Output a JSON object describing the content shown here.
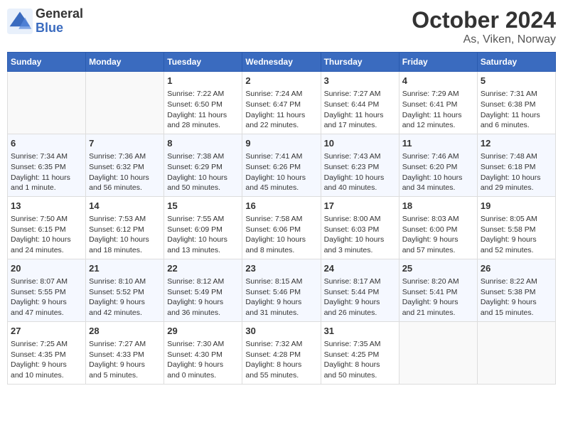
{
  "header": {
    "logo_line1": "General",
    "logo_line2": "Blue",
    "title": "October 2024",
    "subtitle": "As, Viken, Norway"
  },
  "weekdays": [
    "Sunday",
    "Monday",
    "Tuesday",
    "Wednesday",
    "Thursday",
    "Friday",
    "Saturday"
  ],
  "weeks": [
    [
      {
        "day": "",
        "info": ""
      },
      {
        "day": "",
        "info": ""
      },
      {
        "day": "1",
        "info": "Sunrise: 7:22 AM\nSunset: 6:50 PM\nDaylight: 11 hours\nand 28 minutes."
      },
      {
        "day": "2",
        "info": "Sunrise: 7:24 AM\nSunset: 6:47 PM\nDaylight: 11 hours\nand 22 minutes."
      },
      {
        "day": "3",
        "info": "Sunrise: 7:27 AM\nSunset: 6:44 PM\nDaylight: 11 hours\nand 17 minutes."
      },
      {
        "day": "4",
        "info": "Sunrise: 7:29 AM\nSunset: 6:41 PM\nDaylight: 11 hours\nand 12 minutes."
      },
      {
        "day": "5",
        "info": "Sunrise: 7:31 AM\nSunset: 6:38 PM\nDaylight: 11 hours\nand 6 minutes."
      }
    ],
    [
      {
        "day": "6",
        "info": "Sunrise: 7:34 AM\nSunset: 6:35 PM\nDaylight: 11 hours\nand 1 minute."
      },
      {
        "day": "7",
        "info": "Sunrise: 7:36 AM\nSunset: 6:32 PM\nDaylight: 10 hours\nand 56 minutes."
      },
      {
        "day": "8",
        "info": "Sunrise: 7:38 AM\nSunset: 6:29 PM\nDaylight: 10 hours\nand 50 minutes."
      },
      {
        "day": "9",
        "info": "Sunrise: 7:41 AM\nSunset: 6:26 PM\nDaylight: 10 hours\nand 45 minutes."
      },
      {
        "day": "10",
        "info": "Sunrise: 7:43 AM\nSunset: 6:23 PM\nDaylight: 10 hours\nand 40 minutes."
      },
      {
        "day": "11",
        "info": "Sunrise: 7:46 AM\nSunset: 6:20 PM\nDaylight: 10 hours\nand 34 minutes."
      },
      {
        "day": "12",
        "info": "Sunrise: 7:48 AM\nSunset: 6:18 PM\nDaylight: 10 hours\nand 29 minutes."
      }
    ],
    [
      {
        "day": "13",
        "info": "Sunrise: 7:50 AM\nSunset: 6:15 PM\nDaylight: 10 hours\nand 24 minutes."
      },
      {
        "day": "14",
        "info": "Sunrise: 7:53 AM\nSunset: 6:12 PM\nDaylight: 10 hours\nand 18 minutes."
      },
      {
        "day": "15",
        "info": "Sunrise: 7:55 AM\nSunset: 6:09 PM\nDaylight: 10 hours\nand 13 minutes."
      },
      {
        "day": "16",
        "info": "Sunrise: 7:58 AM\nSunset: 6:06 PM\nDaylight: 10 hours\nand 8 minutes."
      },
      {
        "day": "17",
        "info": "Sunrise: 8:00 AM\nSunset: 6:03 PM\nDaylight: 10 hours\nand 3 minutes."
      },
      {
        "day": "18",
        "info": "Sunrise: 8:03 AM\nSunset: 6:00 PM\nDaylight: 9 hours\nand 57 minutes."
      },
      {
        "day": "19",
        "info": "Sunrise: 8:05 AM\nSunset: 5:58 PM\nDaylight: 9 hours\nand 52 minutes."
      }
    ],
    [
      {
        "day": "20",
        "info": "Sunrise: 8:07 AM\nSunset: 5:55 PM\nDaylight: 9 hours\nand 47 minutes."
      },
      {
        "day": "21",
        "info": "Sunrise: 8:10 AM\nSunset: 5:52 PM\nDaylight: 9 hours\nand 42 minutes."
      },
      {
        "day": "22",
        "info": "Sunrise: 8:12 AM\nSunset: 5:49 PM\nDaylight: 9 hours\nand 36 minutes."
      },
      {
        "day": "23",
        "info": "Sunrise: 8:15 AM\nSunset: 5:46 PM\nDaylight: 9 hours\nand 31 minutes."
      },
      {
        "day": "24",
        "info": "Sunrise: 8:17 AM\nSunset: 5:44 PM\nDaylight: 9 hours\nand 26 minutes."
      },
      {
        "day": "25",
        "info": "Sunrise: 8:20 AM\nSunset: 5:41 PM\nDaylight: 9 hours\nand 21 minutes."
      },
      {
        "day": "26",
        "info": "Sunrise: 8:22 AM\nSunset: 5:38 PM\nDaylight: 9 hours\nand 15 minutes."
      }
    ],
    [
      {
        "day": "27",
        "info": "Sunrise: 7:25 AM\nSunset: 4:35 PM\nDaylight: 9 hours\nand 10 minutes."
      },
      {
        "day": "28",
        "info": "Sunrise: 7:27 AM\nSunset: 4:33 PM\nDaylight: 9 hours\nand 5 minutes."
      },
      {
        "day": "29",
        "info": "Sunrise: 7:30 AM\nSunset: 4:30 PM\nDaylight: 9 hours\nand 0 minutes."
      },
      {
        "day": "30",
        "info": "Sunrise: 7:32 AM\nSunset: 4:28 PM\nDaylight: 8 hours\nand 55 minutes."
      },
      {
        "day": "31",
        "info": "Sunrise: 7:35 AM\nSunset: 4:25 PM\nDaylight: 8 hours\nand 50 minutes."
      },
      {
        "day": "",
        "info": ""
      },
      {
        "day": "",
        "info": ""
      }
    ]
  ]
}
